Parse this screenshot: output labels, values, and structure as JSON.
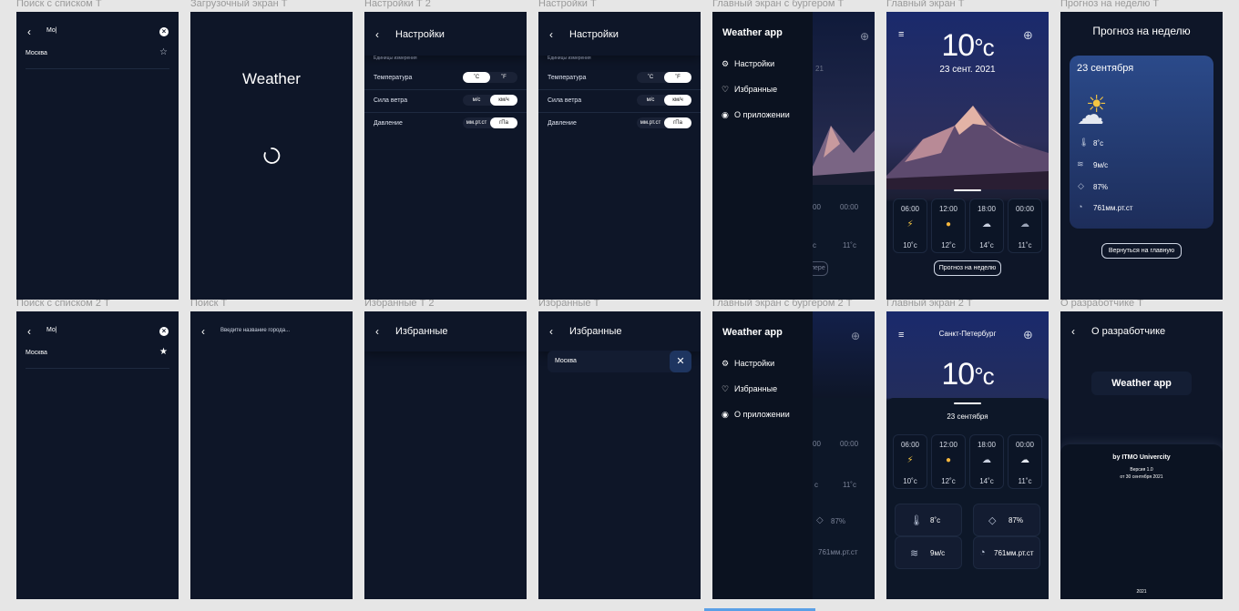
{
  "frames": {
    "f1": "Поиск с списком Т",
    "f2": "Загрузочный экран Т",
    "f3": "Настройки Т 2",
    "f4": "Настройки Т",
    "f5": "Главный экран с бургером Т",
    "f6": "Главный экран Т",
    "f7": "Прогноз на неделю Т",
    "f8": "Поиск с списком 2 Т",
    "f9": "Поиск Т",
    "f10": "Избранные Т 2",
    "f11": "Избранные Т",
    "f12": "Главный экран с бургером 2 Т",
    "f13": "Главный экран 2 Т",
    "f14": "О разработчике Т"
  },
  "search": {
    "query": "Mo|",
    "result": "Москва",
    "placeholder": "Введите название города..."
  },
  "loading": {
    "title": "Weather"
  },
  "settings": {
    "title": "Настройки",
    "section": "Единицы измерения",
    "temp": "Температура",
    "wind": "Сила ветра",
    "pressure": "Давление",
    "c": "˚C",
    "f": "˚F",
    "ms": "м/с",
    "kmh": "км/ч",
    "mmhg": "мм.рт.ст",
    "hpa": "гПа"
  },
  "menu": {
    "app": "Weather app",
    "settings": "Настройки",
    "favorites": "Избранные",
    "about": "О приложении"
  },
  "main": {
    "temp": "10",
    "unit": "°c",
    "date": "23 сент. 2021",
    "city": "Санкт-Петербург",
    "date2": "23 сентября",
    "week_btn": "Прогноз на неделю",
    "edge_btn": "пере"
  },
  "hours": [
    {
      "h": "06:00",
      "t": "10˚c"
    },
    {
      "h": "12:00",
      "t": "12˚c"
    },
    {
      "h": "18:00",
      "t": "14˚c"
    },
    {
      "h": "00:00",
      "t": "11˚c"
    }
  ],
  "partial": {
    "h1": "00",
    "h2": "00:00",
    "t1": "˚c",
    "t2": "11˚c",
    "c": "c",
    "hum": "87%",
    "pres": "761мм.рт.ст"
  },
  "stats": {
    "temp": "8˚c",
    "wind": "9м/с",
    "hum": "87%",
    "pres": "761мм.рт.ст"
  },
  "week": {
    "title": "Прогноз на неделю",
    "date": "23 сентября",
    "back_btn": "Вернуться на главную"
  },
  "favorites": {
    "title": "Избранные",
    "item": "Москва"
  },
  "about": {
    "title": "О разработчике",
    "app": "Weather app",
    "by": "by ITMO Univercity",
    "version": "Версия 1.0",
    "date": "от 30 сентября 2021",
    "year": "2021"
  },
  "icons": [
    "back-icon",
    "clear-icon",
    "star-icon",
    "star-filled-icon",
    "spinner-icon",
    "gear-icon",
    "heart-icon",
    "user-icon",
    "plus-icon",
    "menu-icon",
    "thermometer-icon",
    "wind-icon",
    "drop-icon",
    "gauge-icon",
    "close-icon"
  ]
}
